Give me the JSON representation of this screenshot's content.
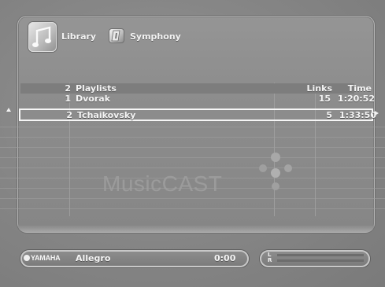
{
  "header": {
    "music_icon": "music-note-icon",
    "library_label": "Library",
    "album_icon": "album-icon",
    "album_label": "Symphony"
  },
  "table": {
    "header": {
      "count": "2",
      "title": "Playlists",
      "links": "Links",
      "time": "Time"
    },
    "rows": [
      {
        "num": "1",
        "name": "Dvorak",
        "links": "15",
        "time": "1:20:52",
        "selected": false
      },
      {
        "num": "2",
        "name": "Tchaikovsky",
        "links": "5",
        "time": "1:33:50",
        "selected": true
      }
    ]
  },
  "watermark": "MusicCAST",
  "player": {
    "brand": "YAMAHA",
    "track": "Allegro",
    "elapsed": "0:00"
  },
  "meter": {
    "left_label": "L",
    "right_label": "R"
  },
  "colors": {
    "text": "#f4f4f4",
    "panel": "#8d8d8d",
    "selection": "#f6f6f6"
  }
}
